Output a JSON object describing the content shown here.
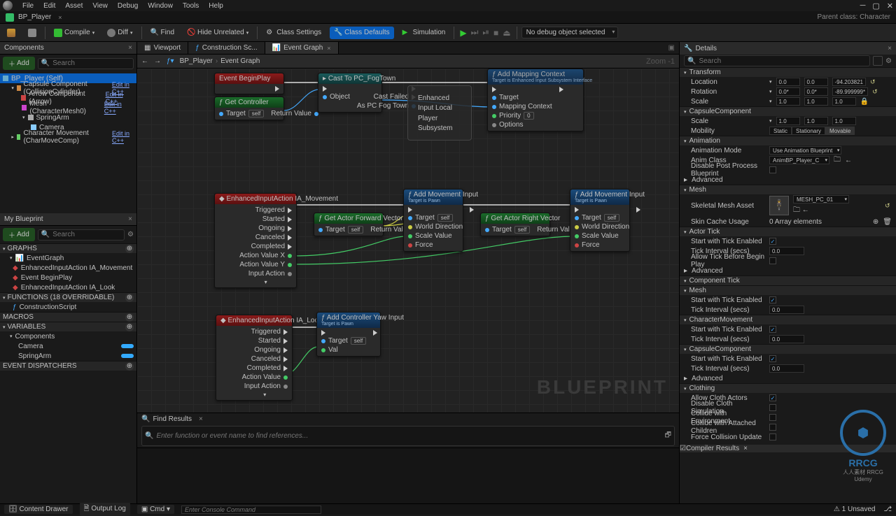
{
  "menus": [
    "File",
    "Edit",
    "Asset",
    "View",
    "Debug",
    "Window",
    "Tools",
    "Help"
  ],
  "title_asset": "BP_Player",
  "title_right": "Parent class: Character",
  "toolbar": {
    "compile": "Compile",
    "diff": "Diff",
    "find": "Find",
    "hide": "Hide Unrelated",
    "classsettings": "Class Settings",
    "classdefaults": "Class Defaults",
    "simulation": "Simulation",
    "debug_selected": "No debug object selected"
  },
  "components": {
    "header": "Components",
    "add": "Add",
    "search_placeholder": "Search",
    "tree": [
      {
        "indent": 0,
        "label": "BP_Player (Self)",
        "sel": true
      },
      {
        "indent": 1,
        "label": "Capsule Component (CollisionCylinder)",
        "edit": "Edit in C++"
      },
      {
        "indent": 2,
        "label": "Arrow Component (Arrow)",
        "edit": "Edit in C++"
      },
      {
        "indent": 2,
        "label": "Mesh (CharacterMesh0)",
        "edit": "Edit in C++"
      },
      {
        "indent": 2,
        "label": "SpringArm"
      },
      {
        "indent": 3,
        "label": "Camera"
      },
      {
        "indent": 1,
        "label": "Character Movement (CharMoveComp)",
        "edit": "Edit in C++"
      }
    ]
  },
  "myblueprint": {
    "header": "My Blueprint",
    "add": "Add",
    "search_placeholder": "Search",
    "sections": {
      "graphs": "GRAPHS",
      "functions": "FUNCTIONS (18 OVERRIDABLE)",
      "macros": "MACROS",
      "variables": "VARIABLES",
      "dispatchers": "EVENT DISPATCHERS"
    },
    "graphs": [
      {
        "label": "EventGraph",
        "indent": 1
      },
      {
        "label": "EnhancedInputAction IA_Movement",
        "indent": 2
      },
      {
        "label": "Event BeginPlay",
        "indent": 2
      },
      {
        "label": "EnhancedInputAction IA_Look",
        "indent": 2
      }
    ],
    "functions": [
      "ConstructionScript"
    ],
    "vars_groups": [
      "Components"
    ],
    "vars": [
      "Camera",
      "SpringArm"
    ]
  },
  "center": {
    "tabs": [
      {
        "label": "Viewport"
      },
      {
        "label": "Construction Sc..."
      },
      {
        "label": "Event Graph",
        "active": true
      }
    ],
    "crumb_root": "BP_Player",
    "crumb_leaf": "Event Graph",
    "zoom": "Zoom  -1",
    "watermark": "BLUEPRINT"
  },
  "nodes": {
    "beginplay": "Event BeginPlay",
    "getcontroller": "Get Controller",
    "getcontroller_target": "Target",
    "getcontroller_self": "self",
    "getcontroller_return": "Return Value",
    "cast": "Cast To PC_FogTown",
    "cast_object": "Object",
    "cast_failed": "Cast Failed",
    "cast_as": "As PC Fog Town",
    "subsystem": "Enhanced Input Local Player Subsystem",
    "addcontext": "Add Mapping Context",
    "addcontext_sub": "Target is Enhanced Input Subsystem Interface",
    "addcontext_target": "Target",
    "addcontext_mapping": "Mapping Context",
    "addcontext_priority": "Priority",
    "addcontext_priority_val": "0",
    "addcontext_options": "Options",
    "eia_move": "EnhancedInputAction IA_Movement",
    "eia_look": "EnhancedInputAction IA_Look",
    "pin_triggered": "Triggered",
    "pin_started": "Started",
    "pin_ongoing": "Ongoing",
    "pin_canceled": "Canceled",
    "pin_completed": "Completed",
    "pin_actionx": "Action Value X",
    "pin_actiony": "Action Value Y",
    "pin_actionval": "Action Value",
    "pin_inputaction": "Input Action",
    "getfwd": "Get Actor Forward Vector",
    "getright": "Get Actor Right Vector",
    "target_self": "Target  self",
    "return_value": "Return Value",
    "addmove": "Add Movement Input",
    "addmove_sub": "Target is Pawn",
    "pin_target": "Target",
    "pin_self": "self",
    "pin_worlddir": "World Direction",
    "pin_scale": "Scale Value",
    "pin_force": "Force",
    "addyaw": "Add Controller Yaw Input",
    "pin_val": "Val"
  },
  "find": {
    "header": "Find Results",
    "placeholder": "Enter function or event name to find references..."
  },
  "details": {
    "header": "Details",
    "search_placeholder": "Search",
    "transform": "Transform",
    "location": "Location",
    "rotation": "Rotation",
    "scale": "Scale",
    "loc": [
      "0.0",
      "0.0",
      "-94.203821"
    ],
    "rot": [
      "0.0*",
      "0.0*",
      "-89.999999*"
    ],
    "scl": [
      "1.0",
      "1.0",
      "1.0"
    ],
    "capsule": "CapsuleComponent",
    "cscl": [
      "1.0",
      "1.0",
      "1.0"
    ],
    "mobility": "Mobility",
    "mob_vals": [
      "Static",
      "Stationary",
      "Movable"
    ],
    "animation": "Animation",
    "animmode": "Animation Mode",
    "animmode_val": "Use Animation Blueprint",
    "animclass": "Anim Class",
    "animclass_val": "AnimBP_Player_C",
    "disablepp": "Disable Post Process Blueprint",
    "advanced": "Advanced",
    "mesh": "Mesh",
    "skelmesh": "Skeletal Mesh Asset",
    "skelmesh_val": "MESH_PC_01",
    "skincache": "Skin Cache Usage",
    "arrayelem": "0 Array elements",
    "actortick": "Actor Tick",
    "starttick": "Start with Tick Enabled",
    "tickint": "Tick Interval (secs)",
    "tickint_val": "0.0",
    "allowbefore": "Allow Tick Before Begin Play",
    "componenttick": "Component Tick",
    "charmovement": "CharacterMovement",
    "capsulecomp": "CapsuleComponent",
    "clothing": "Clothing",
    "allowcloth": "Allow Cloth Actors",
    "disablecloth": "Disable Cloth Simulation",
    "collideenv": "Collide with Environment",
    "collidechild": "Collide with Attached Children",
    "forcecoll": "Force Collision Update",
    "compiler": "Compiler Results"
  },
  "status": {
    "drawer": "Content Drawer",
    "output": "Output Log",
    "cmd": "Cmd",
    "cmd_placeholder": "Enter Console Command",
    "unsaved": "1 Unsaved",
    "brand": "Udemy"
  },
  "wmark_brand": "RRCG",
  "wmark_sub": "人人素材 RRCG"
}
